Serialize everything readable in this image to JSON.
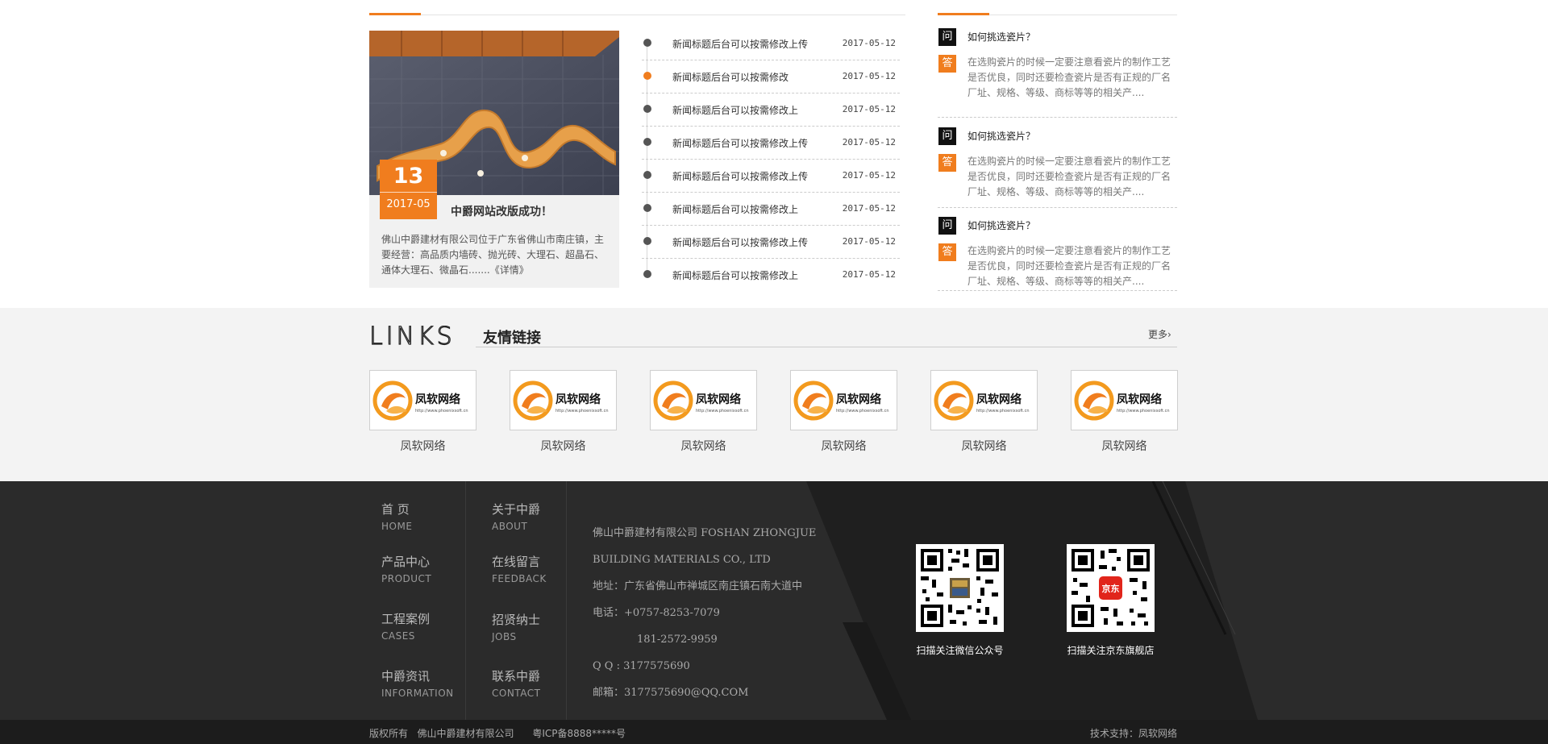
{
  "news": {
    "date_day": "13",
    "date_ym": "2017-05",
    "title": "中爵网站改版成功！",
    "desc": "佛山中爵建材有限公司位于广东省佛山市南庄镇，主要经营：高品质内墙砖、抛光砖、大理石、超晶石、通体大理石、微晶石.......《详情》"
  },
  "news_list": [
    {
      "title": "新闻标题后台可以按需修改上传",
      "date": "2017-05-12"
    },
    {
      "title": "新闻标题后台可以按需修改",
      "date": "2017-05-12"
    },
    {
      "title": "新闻标题后台可以按需修改上",
      "date": "2017-05-12"
    },
    {
      "title": "新闻标题后台可以按需修改上传",
      "date": "2017-05-12"
    },
    {
      "title": "新闻标题后台可以按需修改上传",
      "date": "2017-05-12"
    },
    {
      "title": "新闻标题后台可以按需修改上",
      "date": "2017-05-12"
    },
    {
      "title": "新闻标题后台可以按需修改上传",
      "date": "2017-05-12"
    },
    {
      "title": "新闻标题后台可以按需修改上",
      "date": "2017-05-12"
    }
  ],
  "faq": {
    "q_label": "问",
    "a_label": "答",
    "items": [
      {
        "q": "如何挑选瓷片？",
        "a": "在选购瓷片的时候一定要注意看瓷片的制作工艺是否优良，同时还要检查瓷片是否有正规的厂名厂址、规格、等级、商标等等的相关产...."
      },
      {
        "q": "如何挑选瓷片？",
        "a": "在选购瓷片的时候一定要注意看瓷片的制作工艺是否优良，同时还要检查瓷片是否有正规的厂名厂址、规格、等级、商标等等的相关产...."
      },
      {
        "q": "如何挑选瓷片？",
        "a": "在选购瓷片的时候一定要注意看瓷片的制作工艺是否优良，同时还要检查瓷片是否有正规的厂名厂址、规格、等级、商标等等的相关产...."
      }
    ]
  },
  "links": {
    "title_en": "LINKS",
    "title_cn": "友情链接",
    "more": "更多›",
    "logo_text": "凤软网络",
    "logo_url": "http://www.phoenixsoft.cn",
    "items": [
      "凤软网络",
      "凤软网络",
      "凤软网络",
      "凤软网络",
      "凤软网络",
      "凤软网络"
    ]
  },
  "footer": {
    "nav_left": [
      {
        "cn": "首  页",
        "en": "HOME"
      },
      {
        "cn": "产品中心",
        "en": "PRODUCT"
      },
      {
        "cn": "工程案例",
        "en": "CASES"
      },
      {
        "cn": "中爵资讯",
        "en": "INFORMATION"
      }
    ],
    "nav_right": [
      {
        "cn": "关于中爵",
        "en": "ABOUT"
      },
      {
        "cn": "在线留言",
        "en": "FEEDBACK"
      },
      {
        "cn": "招贤纳士",
        "en": "JOBS"
      },
      {
        "cn": "联系中爵",
        "en": "CONTACT"
      }
    ],
    "company_line1": "佛山中爵建材有限公司 FOSHAN ZHONGJUE",
    "company_line2": "BUILDING MATERIALS CO., LTD",
    "address": "地址：广东省佛山市禅城区南庄镇石南大道中",
    "phone1": "电话：+0757-8253-7079",
    "phone2": "181-2572-9959",
    "qq": "Q Q : 3177575690",
    "email": "邮箱：3177575690@QQ.COM",
    "qr_wechat": "扫描关注微信公众号",
    "qr_jd": "扫描关注京东旗舰店",
    "jd_badge": "京东"
  },
  "copyright": {
    "left": "版权所有   佛山中爵建材有限公司      粤ICP备8888*****号",
    "right": "技术支持：凤软网络"
  },
  "colors": {
    "accent": "#f07d1e",
    "footer_bg": "#2b2b2b",
    "links_bg": "#f3f3f3"
  }
}
